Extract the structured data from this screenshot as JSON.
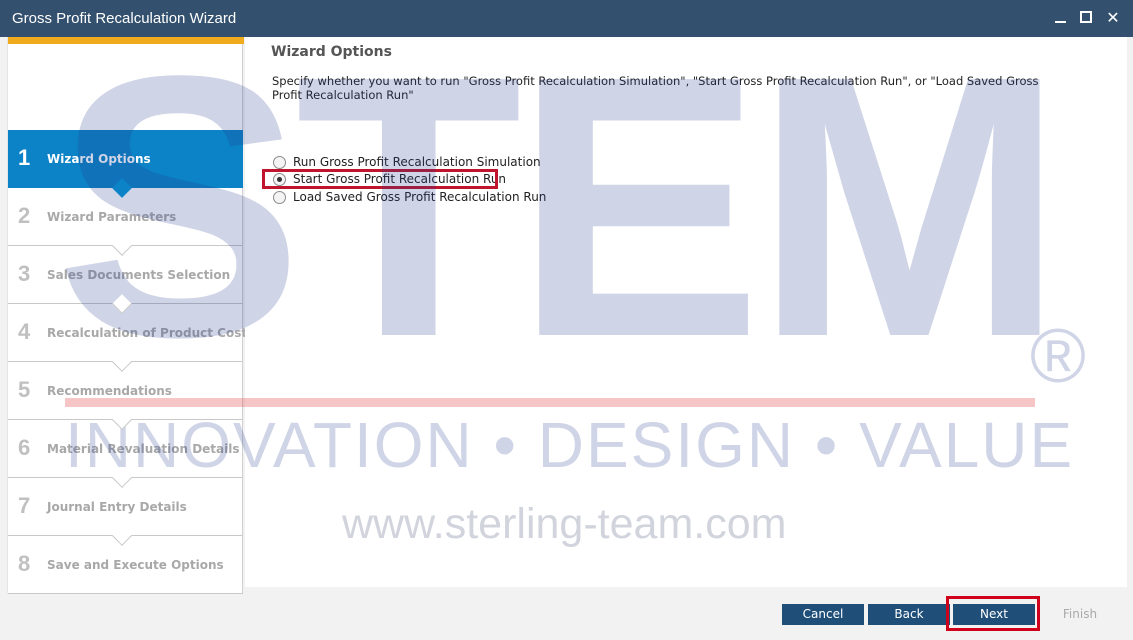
{
  "window": {
    "title": "Gross Profit Recalculation Wizard",
    "controls": [
      "minimize-icon",
      "maximize-icon",
      "close-icon"
    ]
  },
  "steps": [
    {
      "number": "1",
      "label": "Wizard Options",
      "active": true
    },
    {
      "number": "2",
      "label": "Wizard Parameters",
      "active": false
    },
    {
      "number": "3",
      "label": "Sales Documents Selection",
      "active": false
    },
    {
      "number": "4",
      "label": "Recalculation of Product Cost",
      "active": false
    },
    {
      "number": "5",
      "label": "Recommendations",
      "active": false
    },
    {
      "number": "6",
      "label": "Material Revaluation Details",
      "active": false
    },
    {
      "number": "7",
      "label": "Journal Entry Details",
      "active": false
    },
    {
      "number": "8",
      "label": "Save and Execute Options",
      "active": false
    }
  ],
  "content": {
    "heading": "Wizard Options",
    "description": "Specify whether you want to run \"Gross Profit Recalculation Simulation\", \"Start Gross Profit Recalculation Run\", or \"Load Saved Gross Profit Recalculation Run\"",
    "options": [
      {
        "label": "Run Gross Profit Recalculation Simulation",
        "checked": false
      },
      {
        "label": "Start Gross Profit Recalculation Run",
        "checked": true
      },
      {
        "label": "Load Saved Gross Profit Recalculation Run",
        "checked": false
      }
    ]
  },
  "watermark": {
    "brand": "STEM",
    "registered": "®",
    "tagline": "INNOVATION • DESIGN • VALUE",
    "url": "www.sterling-team.com"
  },
  "buttons": {
    "cancel": "Cancel",
    "back": "Back",
    "next": "Next",
    "finish": "Finish"
  },
  "colors": {
    "titlebar": "#33506e",
    "active_step": "#0b83c6",
    "accent": "#f0aa1e",
    "button": "#1f4f79",
    "highlight": "#c0152d"
  }
}
